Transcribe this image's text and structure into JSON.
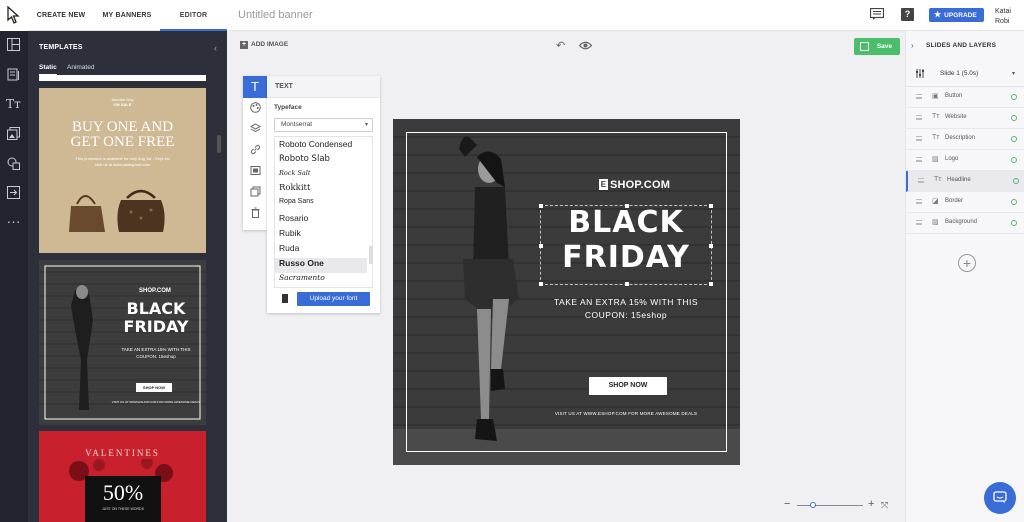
{
  "header": {
    "tabs": [
      {
        "label": "CREATE NEW"
      },
      {
        "label": "MY BANNERS"
      },
      {
        "label": "EDITOR"
      }
    ],
    "doc_title": "Untitled banner",
    "upgrade_label": "UPGRADE",
    "help_label": "?",
    "user_first": "Katai",
    "user_last": "Robi"
  },
  "templates": {
    "title": "TEMPLATES",
    "subtabs": [
      "Static",
      "Animated"
    ],
    "thumb1": {
      "top": "Autumn Day",
      "sale": "ON SALE",
      "line1": "BUY ONE AND",
      "line2": "GET ONE FREE",
      "body1": "This promotion is available for only Aug 1st - Sept 1st",
      "body2": "Visit us at www.adsbypixel.com"
    },
    "thumb2": {
      "logo": "SHOP.COM",
      "headline1": "BLACK",
      "headline2": "FRIDAY",
      "desc1": "TAKE AN EXTRA 15% WITH THIS",
      "desc2": "COUPON: 15eshop",
      "button": "SHOP NOW",
      "site": "VISIT US AT WWW.ESHOP.COM FOR MORE AWESOME DEALS"
    },
    "thumb3": {
      "title": "VALENTINES",
      "big": "50%",
      "sub": "JUST ON THESE WORDS"
    }
  },
  "toolbar": {
    "add_image": "ADD IMAGE",
    "save": "Save"
  },
  "text_panel": {
    "title": "TEXT",
    "typeface_label": "Typeface",
    "typeface_value": "Montserrat",
    "fonts": [
      "Roboto Condensed",
      "Roboto Slab",
      "Rock Salt",
      "Rokkitt",
      "Ropa Sans",
      "Rosario",
      "Rubik",
      "Ruda",
      "Russo One",
      "Sacramento"
    ],
    "upload_font": "Upload your font"
  },
  "banner": {
    "logo": "SHOP.COM",
    "headline1": "BLACK",
    "headline2": "FRIDAY",
    "desc1": "TAKE AN EXTRA 15% WITH THIS",
    "desc2": "COUPON: 15eshop",
    "button": "SHOP NOW",
    "website": "VISIT US AT WWW.ESHOP.COM FOR MORE AWESOME DEALS"
  },
  "right_panel": {
    "title": "SLIDES AND LAYERS",
    "slide_label": "Slide 1 (5.0s)",
    "layers": [
      "Button",
      "Website",
      "Description",
      "Logo",
      "Headline",
      "Border",
      "Background"
    ],
    "active_layer": "Headline"
  },
  "colors": {
    "accent": "#3a6cd7",
    "save_green": "#4cbd6a",
    "sidebar_dark": "#22252f",
    "panel_dark": "#2d303b"
  }
}
